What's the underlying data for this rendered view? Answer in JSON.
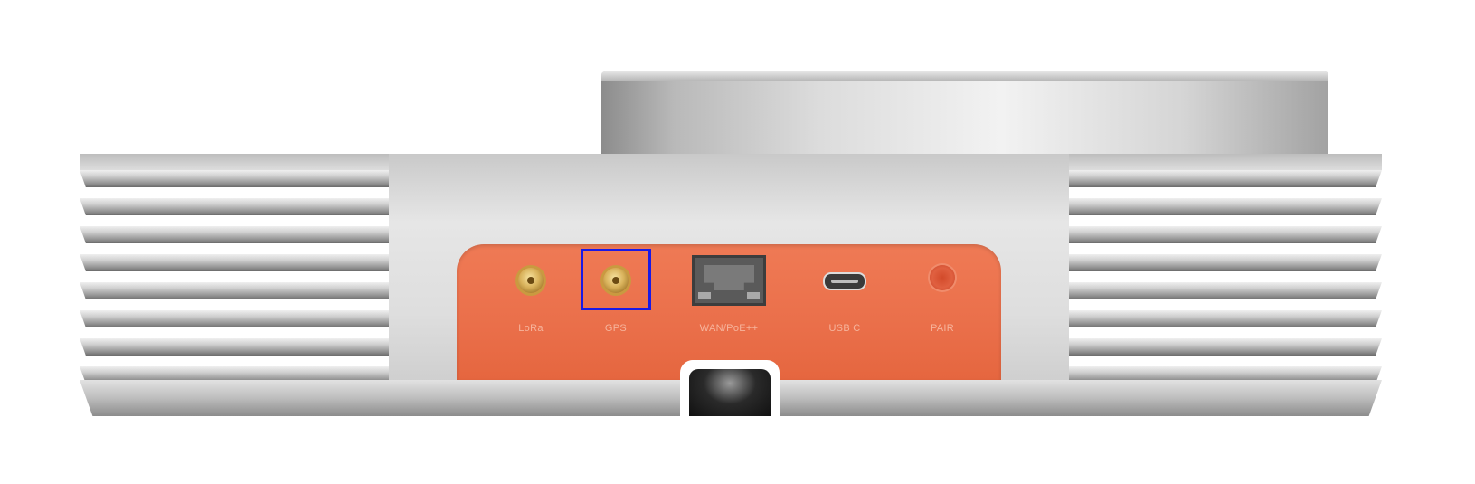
{
  "device": {
    "ports": [
      {
        "label": "LoRa",
        "type": "sma"
      },
      {
        "label": "GPS",
        "type": "sma",
        "highlighted": true
      },
      {
        "label": "WAN/PoE++",
        "type": "rj45"
      },
      {
        "label": "USB C",
        "type": "usb-c"
      },
      {
        "label": "PAIR",
        "type": "button"
      }
    ]
  },
  "colors": {
    "panel": "#ea6f4a",
    "highlight": "#1919e6",
    "body": "#dcdcdc"
  }
}
